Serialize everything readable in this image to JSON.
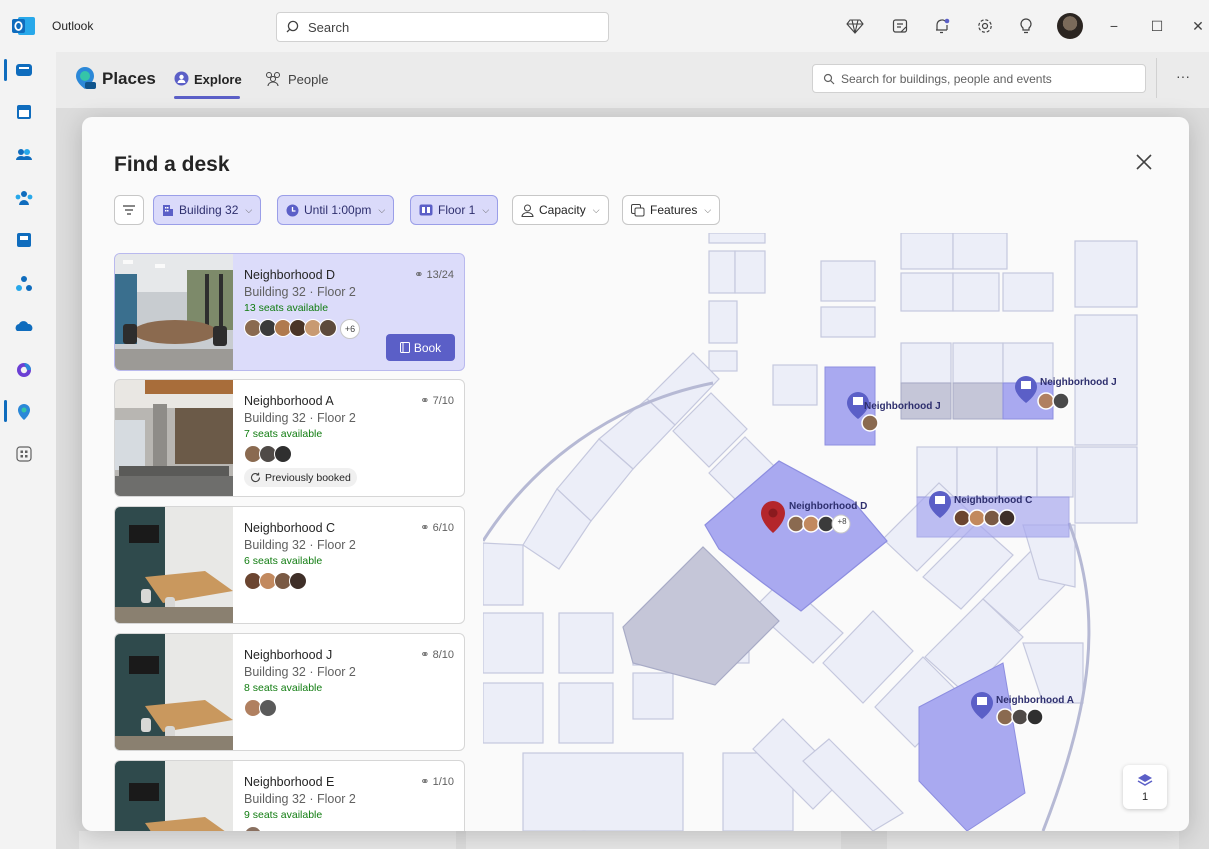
{
  "window": {
    "app_name": "Outlook",
    "search_placeholder": "Search",
    "controls": {
      "minimize": "−",
      "maximize": "☐",
      "close": "✕"
    }
  },
  "rail": {
    "items": [
      "mail",
      "calendar",
      "people",
      "groups",
      "to-do",
      "org-explorer",
      "onedrive",
      "copilot",
      "places",
      "more-apps"
    ]
  },
  "places": {
    "title": "Places",
    "tabs": [
      {
        "label": "Explore",
        "active": true
      },
      {
        "label": "People",
        "active": false
      }
    ],
    "search_placeholder": "Search for buildings, people and events",
    "more": "···"
  },
  "dialog": {
    "title": "Find a desk",
    "filters": [
      {
        "label": "Building 32",
        "selected": true,
        "icon": "building-icon"
      },
      {
        "label": "Until 1:00pm",
        "selected": true,
        "icon": "clock-icon"
      },
      {
        "label": "Floor 1",
        "selected": true,
        "icon": "floor-icon"
      },
      {
        "label": "Capacity",
        "selected": false,
        "icon": "person-icon"
      },
      {
        "label": "Features",
        "selected": false,
        "icon": "features-icon"
      }
    ],
    "cards": [
      {
        "name": "Neighborhood D",
        "location": "Building 32 · Floor 2",
        "availability": "13 seats available",
        "capacity": "13/24",
        "more_people": "+6",
        "book_label": "Book",
        "active": true
      },
      {
        "name": "Neighborhood A",
        "location": "Building 32 · Floor 2",
        "availability": "7 seats available",
        "capacity": "7/10",
        "badge": "Previously booked"
      },
      {
        "name": "Neighborhood C",
        "location": "Building 32 · Floor 2",
        "availability": "6 seats available",
        "capacity": "6/10"
      },
      {
        "name": "Neighborhood J",
        "location": "Building 32 · Floor 2",
        "availability": "8 seats available",
        "capacity": "8/10"
      },
      {
        "name": "Neighborhood E",
        "location": "Building 32 · Floor 2",
        "availability": "9 seats available",
        "capacity": "1/10"
      }
    ],
    "map": {
      "labels": {
        "j_left": "Neighborhood J",
        "j_right": "Neighborhood J",
        "d": "Neighborhood D",
        "c": "Neighborhood C",
        "a": "Neighborhood A"
      },
      "d_more": "+8",
      "floor_number": "1"
    }
  },
  "colors": {
    "accent": "#5b5fc7",
    "selected_chip": "#dadafa",
    "available_text": "#107c10",
    "map_highlight": "#a9a9f0",
    "map_pin_selected": "#b4262b"
  }
}
